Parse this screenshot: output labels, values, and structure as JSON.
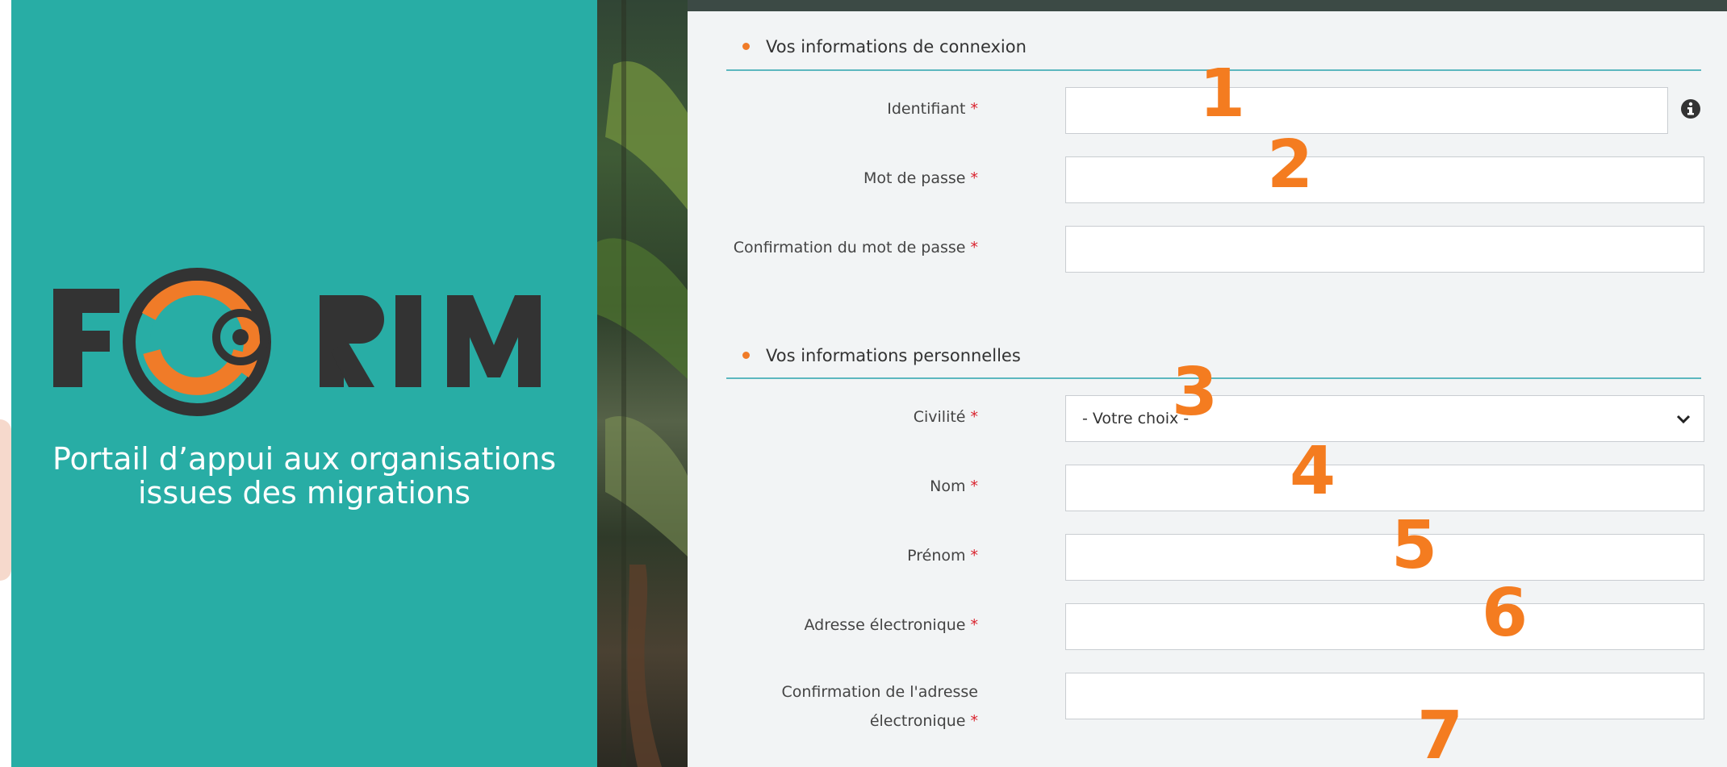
{
  "brand": {
    "logo_text": "FORIM",
    "tagline_line1": "Portail d’appui aux organisations",
    "tagline_line2": "issues des migrations",
    "colors": {
      "teal": "#28ada5",
      "orange": "#f07b28",
      "dark": "#333333"
    }
  },
  "sections": {
    "connexion_title": "Vos informations de connexion",
    "personnelles_title": "Vos informations personnelles"
  },
  "fields": {
    "identifiant": {
      "label": "Identifiant",
      "value": ""
    },
    "mot_de_passe": {
      "label": "Mot de passe",
      "value": ""
    },
    "confirmation_mot_de_passe": {
      "label": "Confirmation du mot de passe",
      "value": ""
    },
    "civilite": {
      "label": "Civilité",
      "selected": "- Votre choix -"
    },
    "nom": {
      "label": "Nom",
      "value": ""
    },
    "prenom": {
      "label": "Prénom",
      "value": ""
    },
    "adresse": {
      "label": "Adresse électronique",
      "value": ""
    },
    "confirmation_adresse": {
      "label_line1": "Confirmation de l'adresse",
      "label_line2": "électronique",
      "value": ""
    }
  },
  "required_marker": "*",
  "annotations": [
    "1",
    "2",
    "3",
    "4",
    "5",
    "6",
    "7"
  ],
  "icons": {
    "info": "info-circle-icon",
    "dropdown": "chevron-down-icon"
  }
}
